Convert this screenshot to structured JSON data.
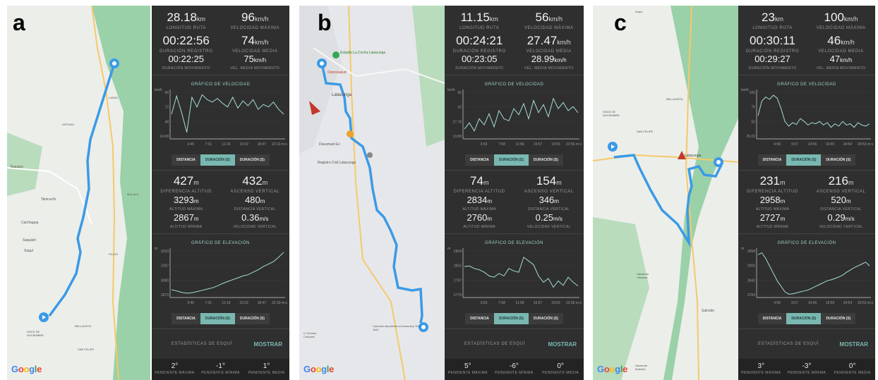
{
  "panels": [
    {
      "letter": "a",
      "stats": {
        "route_length": {
          "v": "28.18",
          "u": "km",
          "l": "LONGITUD RUTA"
        },
        "max_speed": {
          "v": "96",
          "u": "km/h",
          "l": "VELOCIDAD MÁXIMA"
        },
        "duration": {
          "v": "00:22:56",
          "l": "DURACIÓN REGISTRO"
        },
        "avg_speed": {
          "v": "74",
          "u": "km/h",
          "l": "VELOCIDAD MEDIA"
        },
        "moving_time": {
          "v": "00:22:25",
          "l": "DURACIÓN MOVIMIENTO"
        },
        "moving_speed": {
          "v": "75",
          "u": "km/h",
          "l": "VEL. MEDIA MOVIMIENTO"
        },
        "alt_diff": {
          "v": "427",
          "u": "m",
          "l": "DIFERENCIA ALTITUD"
        },
        "vert_ascent": {
          "v": "432",
          "u": "m",
          "l": "ASCENSO VERTICAL"
        },
        "max_alt": {
          "v": "3293",
          "u": "m",
          "l": "ALTITUD MÁXIMA"
        },
        "vert_dist": {
          "v": "480",
          "u": "m",
          "l": "DISTANCIA VERTICAL"
        },
        "min_alt": {
          "v": "2867",
          "u": "m",
          "l": "ALTITUD MÍNIMA"
        },
        "vert_speed": {
          "v": "0.36",
          "u": "m/s",
          "l": "VELOCIDAD VERTICAL"
        },
        "max_slope": {
          "v": "2°",
          "l": "PENDIENTE MÁXIMA"
        },
        "min_slope": {
          "v": "-1°",
          "l": "PENDIENTE MÍNIMA"
        },
        "avg_slope": {
          "v": "1°",
          "l": "PENDIENTE MEDIA"
        }
      },
      "speed_chart": {
        "title": "GRÁFICO DE VELOCIDAD",
        "unit": "km/h",
        "yticks": [
          "96",
          "72",
          "48",
          "24.08"
        ],
        "xticks": [
          "3:45",
          "7:31",
          "11:16",
          "15:02",
          "18:47",
          "22:33 m:s"
        ]
      },
      "elev_chart": {
        "title": "GRÁFICO DE ELEVACIÓN",
        "unit": "m",
        "yticks": [
          "3293",
          "3187",
          "3080",
          "2973"
        ],
        "xticks": [
          "3:45",
          "7:31",
          "11:16",
          "15:02",
          "18:47",
          "22:33 m:s"
        ]
      },
      "map_labels": [
        "Tanicuchi",
        "Carchagua",
        "Saquisilí",
        "Saquí",
        "ONCE DE NOVIEMBRE",
        "BELLAVISTA",
        "SAN FELIPE",
        "Toacazo",
        "ORTUNO",
        "MULALO",
        "PILCHI",
        "LASSO"
      ]
    },
    {
      "letter": "b",
      "stats": {
        "route_length": {
          "v": "11.15",
          "u": "km",
          "l": "LONGITUD RUTA"
        },
        "max_speed": {
          "v": "56",
          "u": "km/h",
          "l": "VELOCIDAD MÁXIMA"
        },
        "duration": {
          "v": "00:24:21",
          "l": "DURACIÓN REGISTRO"
        },
        "avg_speed": {
          "v": "27.47",
          "u": "km/h",
          "l": "VELOCIDAD MEDIA"
        },
        "moving_time": {
          "v": "00:23:05",
          "l": "DURACIÓN MOVIMIENTO"
        },
        "moving_speed": {
          "v": "28.99",
          "u": "km/h",
          "l": "VEL. MEDIA MOVIMIENTO"
        },
        "alt_diff": {
          "v": "74",
          "u": "m",
          "l": "DIFERENCIA ALTITUD"
        },
        "vert_ascent": {
          "v": "154",
          "u": "m",
          "l": "ASCENSO VERTICAL"
        },
        "max_alt": {
          "v": "2834",
          "u": "m",
          "l": "ALTITUD MÁXIMA"
        },
        "vert_dist": {
          "v": "346",
          "u": "m",
          "l": "DISTANCIA VERTICAL"
        },
        "min_alt": {
          "v": "2760",
          "u": "m",
          "l": "ALTITUD MÍNIMA"
        },
        "vert_speed": {
          "v": "0.25",
          "u": "m/s",
          "l": "VELOCIDAD VERTICAL"
        },
        "max_slope": {
          "v": "5°",
          "l": "PENDIENTE MÁXIMA"
        },
        "min_slope": {
          "v": "-6°",
          "l": "PENDIENTE MÍNIMA"
        },
        "avg_slope": {
          "v": "0°",
          "l": "PENDIENTE MEDIA"
        }
      },
      "speed_chart": {
        "title": "GRÁFICO DE VELOCIDAD",
        "unit": "km/h",
        "yticks": [
          "56",
          "42",
          "27.78",
          "13.89"
        ],
        "xticks": [
          "3:59",
          "7:58",
          "11:58",
          "15:57",
          "19:56",
          "23:56 m:s"
        ]
      },
      "elev_chart": {
        "title": "GRÁFICO DE ELEVACIÓN",
        "unit": "m",
        "yticks": [
          "2834",
          "2816",
          "2797",
          "2779"
        ],
        "xticks": [
          "3:59",
          "7:58",
          "11:58",
          "15:57",
          "19:56",
          "23:56 m:s"
        ]
      },
      "map_labels": [
        "Estadio La Cocha Latacunga",
        "Ozonosalud",
        "Latacunga",
        "Registro Civil Latacunga",
        "Dasumant Ec",
        "Canchas deportivas el ecuavoley 'Don Julio'",
        "U Técnica Cotopaxi"
      ]
    },
    {
      "letter": "c",
      "stats": {
        "route_length": {
          "v": "23",
          "u": "km",
          "l": "LONGITUD RUTA"
        },
        "max_speed": {
          "v": "100",
          "u": "km/h",
          "l": "VELOCIDAD MÁXIMA"
        },
        "duration": {
          "v": "00:30:11",
          "l": "DURACIÓN REGISTRO"
        },
        "avg_speed": {
          "v": "46",
          "u": "km/h",
          "l": "VELOCIDAD MEDIA"
        },
        "moving_time": {
          "v": "00:29:27",
          "l": "DURACIÓN MOVIMIENTO"
        },
        "moving_speed": {
          "v": "47",
          "u": "km/h",
          "l": "VEL. MEDIA MOVIMIENTO"
        },
        "alt_diff": {
          "v": "231",
          "u": "m",
          "l": "DIFERENCIA ALTITUD"
        },
        "vert_ascent": {
          "v": "216",
          "u": "m",
          "l": "ASCENSO VERTICAL"
        },
        "max_alt": {
          "v": "2958",
          "u": "m",
          "l": "ALTITUD MÁXIMA"
        },
        "vert_dist": {
          "v": "520",
          "u": "m",
          "l": "DISTANCIA VERTICAL"
        },
        "min_alt": {
          "v": "2727",
          "u": "m",
          "l": "ALTITUD MÍNIMA"
        },
        "vert_speed": {
          "v": "0.29",
          "u": "m/s",
          "l": "VELOCIDAD VERTICAL"
        },
        "max_slope": {
          "v": "3°",
          "l": "PENDIENTE MÁXIMA"
        },
        "min_slope": {
          "v": "-3°",
          "l": "PENDIENTE MÍNIMA"
        },
        "avg_slope": {
          "v": "0°",
          "l": "PENDIENTE MEDIA"
        }
      },
      "speed_chart": {
        "title": "GRÁFICO DE VELOCIDAD",
        "unit": "km/h",
        "yticks": [
          "100",
          "75",
          "50",
          "25.02"
        ],
        "xticks": [
          "4:58",
          "9:57",
          "14:56",
          "19:55",
          "24:54",
          "29:53 m:s"
        ]
      },
      "elev_chart": {
        "title": "GRÁFICO DE ELEVACIÓN",
        "unit": "m",
        "yticks": [
          "2958",
          "2900",
          "2842",
          "2784"
        ],
        "xticks": [
          "4:58",
          "9:57",
          "14:56",
          "19:55",
          "24:54",
          "29:53 m:s"
        ]
      },
      "map_labels": [
        "ONCE DE NOVIEMBRE",
        "BELLAVISTA",
        "SAN FELIPE",
        "Latacunga",
        "Hacienda Yáconez",
        "Salcedo",
        "Hacienda Mulinliví",
        "Saquí"
      ]
    }
  ],
  "controls": {
    "distance": "DISTANCIA",
    "duration1": "DURACIÓN (S)",
    "duration2": "DURACIÓN (S)"
  },
  "ski": {
    "title": "ESTADÍSTICAS DE ESQUÍ",
    "button": "MOSTRAR"
  },
  "google_letters": [
    "G",
    "o",
    "o",
    "g",
    "l",
    "e"
  ],
  "colors": {
    "route": "#3b9ae6",
    "chart_line": "#a6ddd6",
    "stats_bg": "#2f2f2f",
    "accent": "#79b8b1",
    "park": "#8fcb9f"
  },
  "chart_data": [
    {
      "type": "line",
      "title": "GRÁFICO DE VELOCIDAD",
      "ylabel": "km/h",
      "panel": "a",
      "ylim": [
        24,
        96
      ],
      "x": [
        0,
        1,
        2,
        3,
        4,
        5,
        6,
        7,
        8,
        9,
        10,
        11,
        12,
        13,
        14,
        15,
        16,
        17,
        18,
        19,
        20,
        21,
        22
      ],
      "series": [
        {
          "values": [
            60,
            90,
            62,
            30,
            88,
            72,
            92,
            84,
            80,
            86,
            78,
            72,
            88,
            70,
            82,
            74,
            84,
            68,
            76,
            72,
            80,
            68,
            60
          ]
        }
      ]
    },
    {
      "type": "line",
      "title": "GRÁFICO DE ELEVACIÓN",
      "ylabel": "m",
      "panel": "a",
      "ylim": [
        2950,
        3300
      ],
      "x": [
        0,
        1,
        2,
        3,
        4,
        5,
        6,
        7,
        8,
        9,
        10,
        11,
        12,
        13,
        14,
        15,
        16,
        17,
        18,
        19,
        20,
        21,
        22
      ],
      "series": [
        {
          "values": [
            2990,
            2980,
            2968,
            2962,
            2966,
            2975,
            2985,
            2995,
            3005,
            3020,
            3040,
            3055,
            3070,
            3085,
            3100,
            3110,
            3130,
            3150,
            3175,
            3195,
            3215,
            3250,
            3290
          ]
        }
      ]
    },
    {
      "type": "line",
      "title": "GRÁFICO DE VELOCIDAD",
      "ylabel": "km/h",
      "panel": "b",
      "ylim": [
        13,
        56
      ],
      "x": [
        0,
        1,
        2,
        3,
        4,
        5,
        6,
        7,
        8,
        9,
        10,
        11,
        12,
        13,
        14,
        15,
        16,
        17,
        18,
        19,
        20,
        21,
        22,
        23
      ],
      "series": [
        {
          "values": [
            20,
            26,
            18,
            30,
            24,
            35,
            22,
            38,
            30,
            28,
            40,
            34,
            45,
            30,
            48,
            36,
            44,
            32,
            50,
            40,
            46,
            38,
            42,
            36
          ]
        }
      ]
    },
    {
      "type": "line",
      "title": "GRÁFICO DE ELEVACIÓN",
      "ylabel": "m",
      "panel": "b",
      "ylim": [
        2770,
        2840
      ],
      "x": [
        0,
        1,
        2,
        3,
        4,
        5,
        6,
        7,
        8,
        9,
        10,
        11,
        12,
        13,
        14,
        15,
        16,
        17,
        18,
        19,
        20,
        21,
        22,
        23
      ],
      "series": [
        {
          "values": [
            2815,
            2816,
            2812,
            2810,
            2806,
            2800,
            2798,
            2804,
            2800,
            2812,
            2808,
            2806,
            2830,
            2824,
            2818,
            2800,
            2790,
            2796,
            2782,
            2792,
            2785,
            2798,
            2790,
            2784
          ]
        }
      ]
    },
    {
      "type": "line",
      "title": "GRÁFICO DE VELOCIDAD",
      "ylabel": "km/h",
      "panel": "c",
      "ylim": [
        25,
        100
      ],
      "x": [
        0,
        1,
        2,
        3,
        4,
        5,
        6,
        7,
        8,
        9,
        10,
        11,
        12,
        13,
        14,
        15,
        16,
        17,
        18,
        19,
        20,
        21,
        22,
        23,
        24,
        25,
        26,
        27,
        28,
        29
      ],
      "series": [
        {
          "values": [
            60,
            85,
            92,
            88,
            95,
            90,
            72,
            50,
            42,
            48,
            45,
            55,
            50,
            44,
            48,
            46,
            50,
            44,
            48,
            40,
            46,
            42,
            50,
            44,
            46,
            40,
            48,
            44,
            42,
            46
          ]
        }
      ]
    },
    {
      "type": "line",
      "title": "GRÁFICO DE ELEVACIÓN",
      "ylabel": "m",
      "panel": "c",
      "ylim": [
        2725,
        2960
      ],
      "x": [
        0,
        1,
        2,
        3,
        4,
        5,
        6,
        7,
        8,
        9,
        10,
        11,
        12,
        13,
        14,
        15,
        16,
        17,
        18,
        19,
        20,
        21,
        22,
        23,
        24,
        25,
        26,
        27,
        28,
        29
      ],
      "series": [
        {
          "values": [
            2940,
            2950,
            2920,
            2880,
            2840,
            2800,
            2770,
            2740,
            2728,
            2730,
            2735,
            2740,
            2745,
            2750,
            2760,
            2770,
            2780,
            2790,
            2800,
            2805,
            2812,
            2820,
            2830,
            2845,
            2858,
            2870,
            2880,
            2890,
            2900,
            2880
          ]
        }
      ]
    }
  ]
}
